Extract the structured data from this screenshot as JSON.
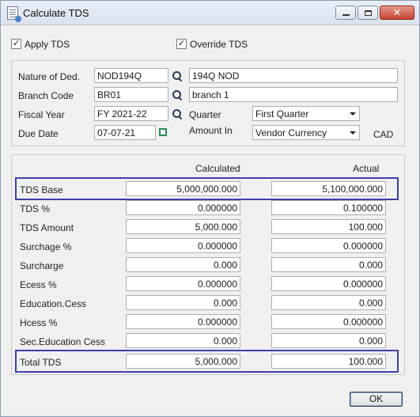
{
  "window": {
    "title": "Calculate TDS"
  },
  "options": {
    "apply_tds": {
      "label": "Apply TDS",
      "checked": true
    },
    "override_tds": {
      "label": "Override TDS",
      "checked": true
    }
  },
  "details": {
    "nature_label": "Nature of Ded.",
    "nature_code": "NOD194Q",
    "nature_name": "194Q NOD",
    "branch_label": "Branch Code",
    "branch_code": "BR01",
    "branch_name": "branch 1",
    "fiscal_label": "Fiscal Year",
    "fiscal_value": "FY 2021-22",
    "quarter_label": "Quarter",
    "quarter_value": "First Quarter",
    "due_label": "Due Date",
    "due_value": "07-07-21",
    "amount_in_label": "Amount In",
    "amount_in_value": "Vendor Currency",
    "currency": "CAD"
  },
  "calc": {
    "calculated_header": "Calculated",
    "actual_header": "Actual",
    "rows": [
      {
        "label": "TDS Base",
        "calculated": "5,000,000.000",
        "actual": "5,100,000.000"
      },
      {
        "label": "TDS %",
        "calculated": "0.000000",
        "actual": "0.100000"
      },
      {
        "label": "TDS Amount",
        "calculated": "5,000.000",
        "actual": "100.000"
      },
      {
        "label": "Surchage %",
        "calculated": "0.000000",
        "actual": "0.000000"
      },
      {
        "label": "Surcharge",
        "calculated": "0.000",
        "actual": "0.000"
      },
      {
        "label": "Ecess %",
        "calculated": "0.000000",
        "actual": "0.000000"
      },
      {
        "label": "Education.Cess",
        "calculated": "0.000",
        "actual": "0.000"
      },
      {
        "label": "Hcess %",
        "calculated": "0.000000",
        "actual": "0.000000"
      },
      {
        "label": "Sec.Education Cess",
        "calculated": "0.000",
        "actual": "0.000"
      },
      {
        "label": "Total TDS",
        "calculated": "5,000.000",
        "actual": "100.000"
      }
    ]
  },
  "actions": {
    "ok_label": "OK"
  },
  "colors": {
    "highlight": "#3d3fa8",
    "calendar_icon": "#2e8b57"
  }
}
